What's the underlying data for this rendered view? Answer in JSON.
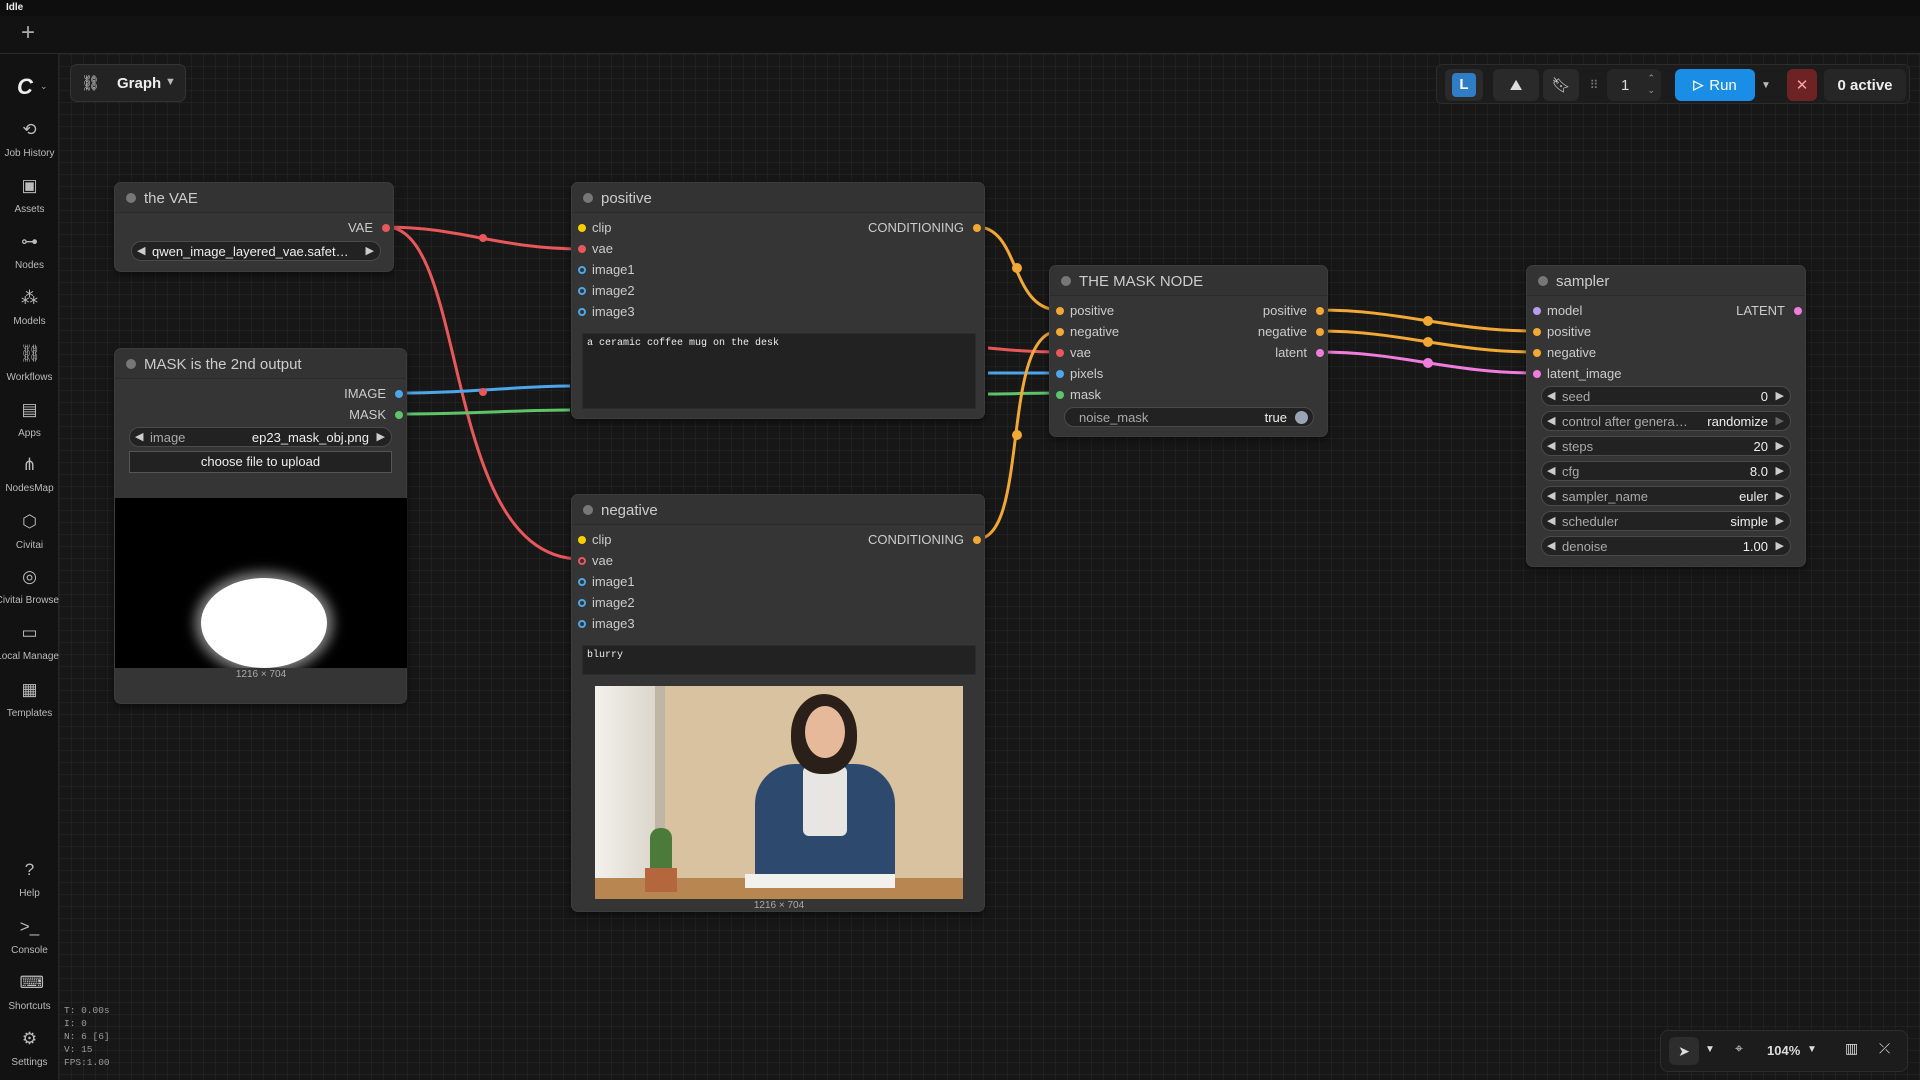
{
  "app": {
    "status": "Idle"
  },
  "sidebar": {
    "items": [
      {
        "label": "Job History",
        "icon": "history-icon"
      },
      {
        "label": "Assets",
        "icon": "image-icon"
      },
      {
        "label": "Nodes",
        "icon": "node-icon"
      },
      {
        "label": "Models",
        "icon": "models-icon"
      },
      {
        "label": "Workflows",
        "icon": "workflow-icon"
      },
      {
        "label": "Apps",
        "icon": "apps-icon"
      },
      {
        "label": "NodesMap",
        "icon": "nodesmap-icon"
      },
      {
        "label": "Civitai",
        "icon": "civitai-icon"
      },
      {
        "label": "Civitai Browse",
        "icon": "globe-icon"
      },
      {
        "label": "Local Manage",
        "icon": "folder-icon"
      },
      {
        "label": "Templates",
        "icon": "templates-icon"
      }
    ],
    "bottom": [
      {
        "label": "Help",
        "icon": "help-icon"
      },
      {
        "label": "Console",
        "icon": "console-icon"
      },
      {
        "label": "Shortcuts",
        "icon": "keyboard-icon"
      },
      {
        "label": "Settings",
        "icon": "gear-icon"
      }
    ]
  },
  "stats": {
    "t": "T: 0.00s",
    "i": "I: 0",
    "n": "N: 6 [6]",
    "v": "V: 15",
    "fps": "FPS:1.00"
  },
  "graph_menu": {
    "label": "Graph"
  },
  "toolbar": {
    "queue_count": "1",
    "run_label": "Run",
    "active_label": "0 active"
  },
  "nodes": {
    "vae": {
      "title": "the VAE",
      "output": "VAE",
      "widget_value": "qwen_image_layered_vae.safet…"
    },
    "mask": {
      "title": "MASK is the 2nd output",
      "outputs": [
        "IMAGE",
        "MASK"
      ],
      "image_label": "image",
      "image_value": "ep23_mask_obj.png",
      "upload_label": "choose file to upload",
      "image_size": "1216 × 704"
    },
    "positive": {
      "title": "positive",
      "inputs": [
        "clip",
        "vae",
        "image1",
        "image2",
        "image3"
      ],
      "output": "CONDITIONING",
      "prompt": "a ceramic coffee mug on the desk"
    },
    "negative": {
      "title": "negative",
      "inputs": [
        "clip",
        "vae",
        "image1",
        "image2",
        "image3"
      ],
      "output": "CONDITIONING",
      "prompt": "blurry",
      "image_size": "1216 × 704"
    },
    "masknode": {
      "title": "THE MASK NODE",
      "inputs": [
        "positive",
        "negative",
        "vae",
        "pixels",
        "mask"
      ],
      "outputs": [
        "positive",
        "negative",
        "latent"
      ],
      "toggle_label": "noise_mask",
      "toggle_value": "true"
    },
    "sampler": {
      "title": "sampler",
      "inputs": [
        "model",
        "positive",
        "negative",
        "latent_image"
      ],
      "output": "LATENT",
      "widgets": [
        {
          "label": "seed",
          "value": "0"
        },
        {
          "label": "control after genera…",
          "value": "randomize"
        },
        {
          "label": "steps",
          "value": "20"
        },
        {
          "label": "cfg",
          "value": "8.0"
        },
        {
          "label": "sampler_name",
          "value": "euler"
        },
        {
          "label": "scheduler",
          "value": "simple"
        },
        {
          "label": "denoise",
          "value": "1.00"
        }
      ]
    }
  },
  "zoom": {
    "level": "104%"
  },
  "colors": {
    "vae": "#e8585a",
    "image": "#4da6ea",
    "mask": "#5ec46a",
    "conditioning": "#f2a834",
    "latent": "#f07ddc",
    "model": "#b79cf0",
    "clip": "#f5d000",
    "run": "#1a8de6"
  }
}
